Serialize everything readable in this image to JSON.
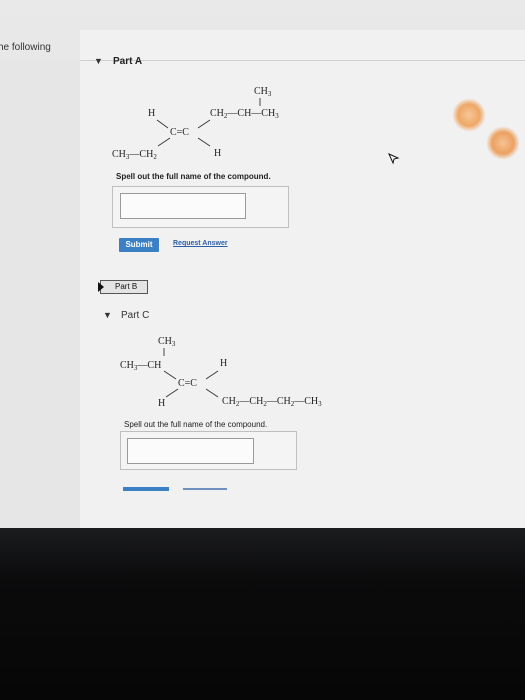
{
  "header": {
    "intro": "he following"
  },
  "partA": {
    "toggle_icon": "caret-down-icon",
    "label": "Part A",
    "molecule": {
      "ch3_top": "CH3",
      "ch2_ch_ch3": "CH2—CH—CH3",
      "h_left": "H",
      "c_double": "C=C",
      "ch3_ch2": "CH3—CH2",
      "h_right": "H"
    },
    "prompt": "Spell out the full name of the compound.",
    "answer_value": "",
    "submit_label": "Submit",
    "request_answer_label": "Request Answer"
  },
  "partB": {
    "toggle_icon": "caret-right-icon",
    "label": "Part B"
  },
  "partC": {
    "toggle_icon": "caret-down-icon",
    "label": "Part C",
    "molecule": {
      "ch3_top": "CH3",
      "ch3_ch": "CH3—CH",
      "h_right": "H",
      "c_double": "C=C",
      "h_bottom": "H",
      "chain": "CH2—CH2—CH2—CH3"
    },
    "prompt": "Spell out the full name of the compound.",
    "answer_value": ""
  },
  "colors": {
    "accent": "#3b7fc4",
    "link": "#2d5fa6"
  }
}
